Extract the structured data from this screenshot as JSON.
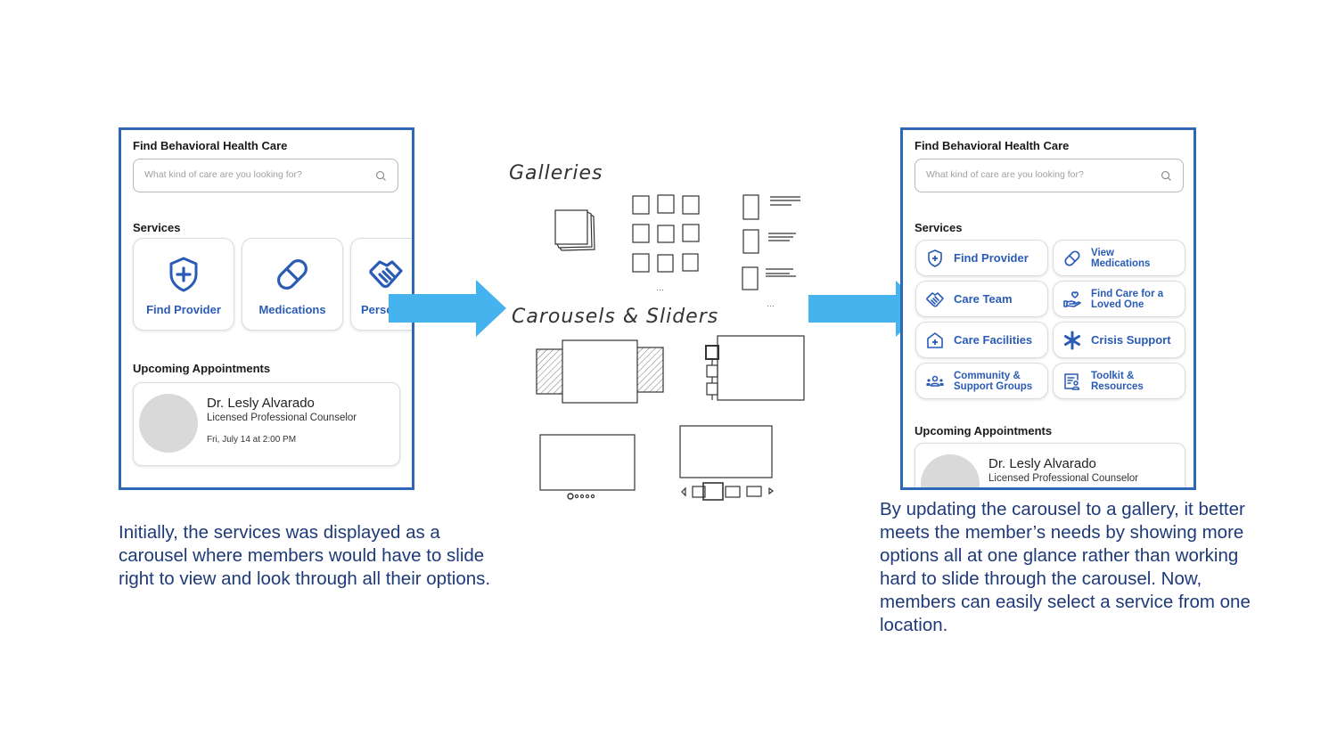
{
  "before_screen": {
    "title": "Find Behavioral Health Care",
    "search": {
      "placeholder": "What kind of care are you looking for?",
      "value": "",
      "icon": "search-icon"
    },
    "services_label": "Services",
    "carousel_cards": [
      {
        "label": "Find Provider",
        "icon": "shield-plus-icon"
      },
      {
        "label": "Medications",
        "icon": "pill-icon"
      },
      {
        "label": "Perso",
        "icon": "handshake-icon"
      }
    ],
    "appointments_label": "Upcoming Appointments",
    "appointment": {
      "name": "Dr. Lesly Alvarado",
      "role": "Licensed Professional Counselor",
      "time": "Fri, July 14 at 2:00 PM"
    }
  },
  "sketch": {
    "galleries_label": "Galleries",
    "carousels_label": "Carousels & Sliders",
    "ellipsis": "..."
  },
  "after_screen": {
    "title": "Find Behavioral Health Care",
    "search": {
      "placeholder": "What kind of care are you looking for?",
      "value": "",
      "icon": "search-icon"
    },
    "services_label": "Services",
    "gallery_buttons": [
      {
        "label": "Find Provider",
        "icon": "shield-plus-icon"
      },
      {
        "label": "View Medications",
        "line1": "View",
        "line2": "Medications",
        "icon": "pill-icon"
      },
      {
        "label": "Care Team",
        "icon": "handshake-icon"
      },
      {
        "label": "Find Care for a Loved One",
        "line1": "Find Care for a",
        "line2": "Loved One",
        "icon": "hand-heart-icon"
      },
      {
        "label": "Care Facilities",
        "icon": "house-plus-icon"
      },
      {
        "label": "Crisis Support",
        "icon": "asterisk-icon"
      },
      {
        "label": "Community & Support Groups",
        "line1": "Community &",
        "line2": "Support Groups",
        "icon": "people-group-icon"
      },
      {
        "label": "Toolkit & Resources",
        "line1": "Toolkit &",
        "line2": "Resources",
        "icon": "document-people-icon"
      }
    ],
    "appointments_label": "Upcoming Appointments",
    "appointment": {
      "name": "Dr. Lesly Alvarado",
      "role": "Licensed Professional Counselor"
    }
  },
  "captions": {
    "before": "Initially, the services was displayed as a carousel where members would have to slide right to view and look through all their options.",
    "after": "By updating the carousel to a gallery, it better meets the member’s needs by showing more options all at one glance rather than working hard to slide through the carousel. Now, members can easily select a service from one location."
  },
  "colors": {
    "frame_border": "#2e66b8",
    "accent_blue": "#2a5bb5",
    "arrow": "#45b3ee",
    "caption_text": "#1f3a78",
    "avatar_placeholder": "#d9d9d9"
  }
}
